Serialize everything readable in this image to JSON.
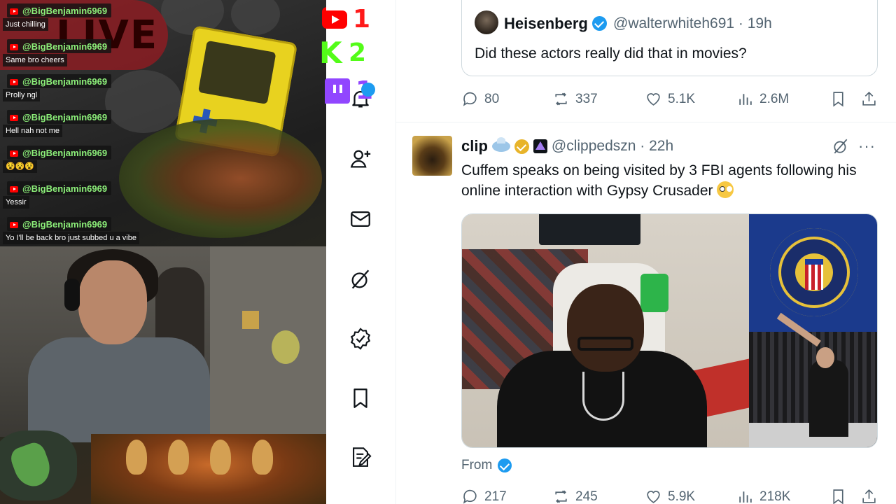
{
  "stream": {
    "overlay_text": "LIVE",
    "chat": [
      {
        "user": "@BigBenjamin6969",
        "message": "Just chilling"
      },
      {
        "user": "@BigBenjamin6969",
        "message": "Same bro cheers"
      },
      {
        "user": "@BigBenjamin6969",
        "message": "Prolly ngl"
      },
      {
        "user": "@BigBenjamin6969",
        "message": "Hell nah not me"
      },
      {
        "user": "@BigBenjamin6969",
        "message": "😵😵😵"
      },
      {
        "user": "@BigBenjamin6969",
        "message": "Yessir"
      },
      {
        "user": "@BigBenjamin6969",
        "message": "Yo I'll be back bro just subbed u a vibe"
      }
    ],
    "viewers": {
      "youtube": "1",
      "kick": "2",
      "twitch": "1"
    },
    "colors": {
      "youtube": "#ff0000",
      "kick": "#53fc18",
      "twitch": "#9146ff",
      "chat_name": "#8df07a"
    }
  },
  "sidebar": {
    "items": [
      {
        "icon": "bell-icon"
      },
      {
        "icon": "person-add-icon"
      },
      {
        "icon": "mail-icon"
      },
      {
        "icon": "grok-icon"
      },
      {
        "icon": "verified-badge-icon"
      },
      {
        "icon": "bookmark-icon"
      },
      {
        "icon": "compose-icon"
      }
    ]
  },
  "quoted_tweet": {
    "name": "Heisenberg",
    "handle": "@walterwhiteh691 · 19h",
    "text": "Did these actors really did that in movies?"
  },
  "tweet1_actions": {
    "replies": "80",
    "reposts": "337",
    "likes": "5.1K",
    "views": "2.6M"
  },
  "tweet2": {
    "name": "clip",
    "handle": "@clippedszn · 22h",
    "text": "Cuffem speaks on being visited by 3 FBI agents following his online interaction with Gypsy Crusader",
    "more": "···",
    "from_label": "From",
    "actions": {
      "replies": "217",
      "reposts": "245",
      "likes": "5.9K",
      "views": "218K"
    }
  },
  "colors": {
    "accent": "#1d9bf0",
    "text_secondary": "#536471",
    "gold_badge": "#e8b42a"
  }
}
